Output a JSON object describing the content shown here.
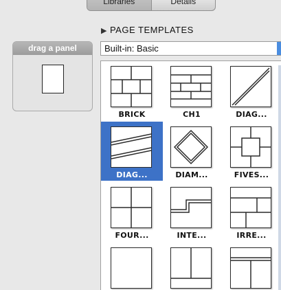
{
  "top_tabs": [
    "Libraries",
    "Details"
  ],
  "drag_panel": {
    "title": "drag a panel"
  },
  "section": {
    "title": "PAGE TEMPLATES",
    "collapse_icon": "disclosure-triangle-icon"
  },
  "select": {
    "value": "Built-in: Basic"
  },
  "templates": [
    {
      "label": "BRICK",
      "selected": false
    },
    {
      "label": "CH1",
      "selected": false
    },
    {
      "label": "DIAG...",
      "selected": false
    },
    {
      "label": "DIAG...",
      "selected": true
    },
    {
      "label": "DIAM...",
      "selected": false
    },
    {
      "label": "FIVES...",
      "selected": false
    },
    {
      "label": "FOUR...",
      "selected": false
    },
    {
      "label": "INTE...",
      "selected": false
    },
    {
      "label": "IRRE...",
      "selected": false
    },
    {
      "label": "",
      "selected": false
    },
    {
      "label": "",
      "selected": false
    },
    {
      "label": "",
      "selected": false
    }
  ],
  "colors": {
    "selection": "#3d72c7",
    "accent": "#4a8de0"
  }
}
